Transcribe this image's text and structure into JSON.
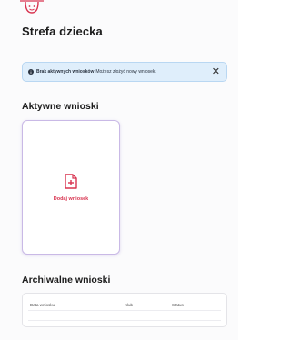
{
  "page": {
    "title": "Strefa dziecka"
  },
  "alert": {
    "strong_text": "Brak aktywnych wniosków",
    "text": "Możesz złożyć nowy wniosek.",
    "icon": "info-icon",
    "close_icon": "close-icon",
    "close_glyph": "✕",
    "info_glyph": "i"
  },
  "active": {
    "section_title": "Aktywne wnioski",
    "add_card_label": "Dodaj wniosek",
    "add_icon": "document-plus-icon"
  },
  "archive": {
    "section_title": "Archiwalne wnioski",
    "columns": [
      "Data wniosku",
      "Klub",
      "Status"
    ],
    "rows": [
      [
        "-",
        "-",
        "-"
      ]
    ]
  },
  "colors": {
    "accent": "#d8334f",
    "alert_bg": "#dfeefb",
    "card_border": "#c9b9e6"
  }
}
